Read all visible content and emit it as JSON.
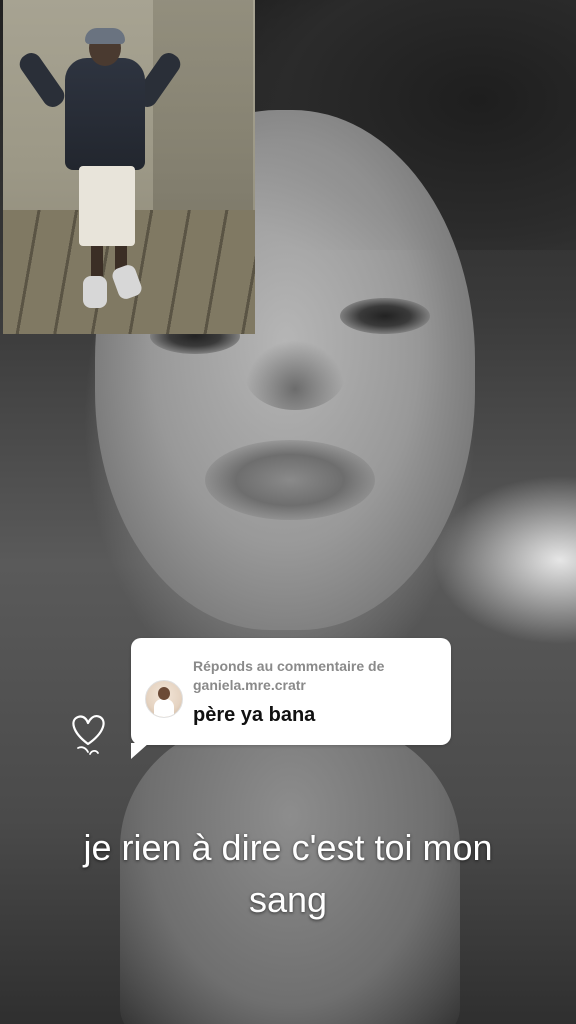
{
  "reply_card": {
    "header_line1": "Réponds au commentaire de",
    "header_line2": "ganiela.mre.cratr",
    "comment_text": "père ya bana"
  },
  "caption": {
    "line1": "je rien à dire c'est toi mon",
    "line2": "sang"
  },
  "colors": {
    "card_background": "#ffffff",
    "card_header_text": "#8a8a8a",
    "comment_text": "#111111",
    "caption_text": "#ffffff"
  },
  "icons": {
    "sticker": "heart-doodle-icon",
    "avatar": "commenter-avatar"
  }
}
